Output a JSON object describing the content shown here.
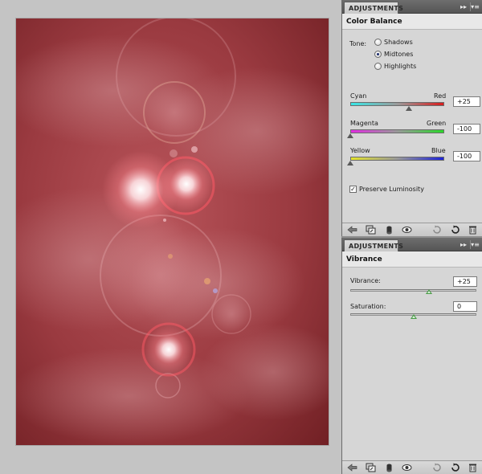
{
  "color_balance_panel": {
    "tab_label": "ADJUSTMENTS",
    "collapse_glyph": "▸▸",
    "menu_glyph": "▾≡",
    "title": "Color Balance",
    "tone": {
      "label": "Tone:",
      "options": [
        "Shadows",
        "Midtones",
        "Highlights"
      ],
      "selected": "Midtones"
    },
    "sliders": [
      {
        "left": "Cyan",
        "right": "Red",
        "value": "+25",
        "fraction": 0.625,
        "gradient": [
          "#38e6e6",
          "#d81c1c"
        ]
      },
      {
        "left": "Magenta",
        "right": "Green",
        "value": "-100",
        "fraction": 0.0,
        "gradient": [
          "#e22ce2",
          "#2ad82a"
        ]
      },
      {
        "left": "Yellow",
        "right": "Blue",
        "value": "-100",
        "fraction": 0.0,
        "gradient": [
          "#e4e42a",
          "#1c22d8"
        ]
      }
    ],
    "preserve_luminosity": {
      "label": "Preserve Luminosity",
      "checked": true,
      "check_glyph": "✓"
    }
  },
  "vibrance_panel": {
    "tab_label": "ADJUSTMENTS",
    "collapse_glyph": "▸▸",
    "menu_glyph": "▾≡",
    "title": "Vibrance",
    "sliders": [
      {
        "label": "Vibrance:",
        "value": "+25",
        "fraction": 0.625
      },
      {
        "label": "Saturation:",
        "value": "0",
        "fraction": 0.5
      }
    ]
  },
  "toolbar_icons": [
    "back-arrow-icon",
    "clip-to-layer-icon",
    "visibility-icon",
    "eye-icon",
    "reset-icon",
    "refresh-icon",
    "trash-icon"
  ],
  "colors": {
    "canvas_red": "#8b2f34",
    "panel_bg": "#d6d6d6",
    "tabbar_dark": "#5f5f5f"
  }
}
